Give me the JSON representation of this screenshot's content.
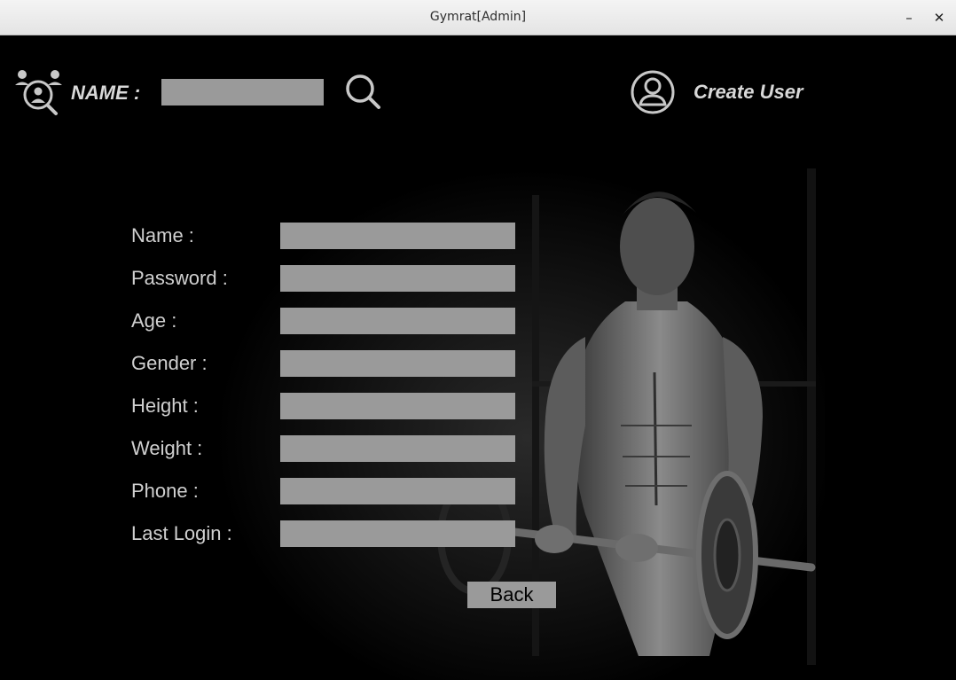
{
  "window": {
    "title": "Gymrat[Admin]",
    "minimize_glyph": "–",
    "close_glyph": "✕"
  },
  "search": {
    "icon_left": "user-search-icon",
    "label": "NAME :",
    "value": "",
    "button_icon": "search-icon"
  },
  "create_user": {
    "icon": "user-circle-icon",
    "label": "Create User"
  },
  "background": {
    "description_icon": "bodybuilder-photo"
  },
  "form": {
    "fields": [
      {
        "label": "Name :",
        "value": ""
      },
      {
        "label": "Password :",
        "value": ""
      },
      {
        "label": "Age :",
        "value": ""
      },
      {
        "label": "Gender :",
        "value": ""
      },
      {
        "label": "Height :",
        "value": ""
      },
      {
        "label": "Weight :",
        "value": ""
      },
      {
        "label": "Phone :",
        "value": ""
      },
      {
        "label": "Last Login :",
        "value": ""
      }
    ],
    "back_label": "Back"
  },
  "colors": {
    "background": "#000000",
    "field": "#9a9a9a",
    "text": "#d0d0d0"
  }
}
